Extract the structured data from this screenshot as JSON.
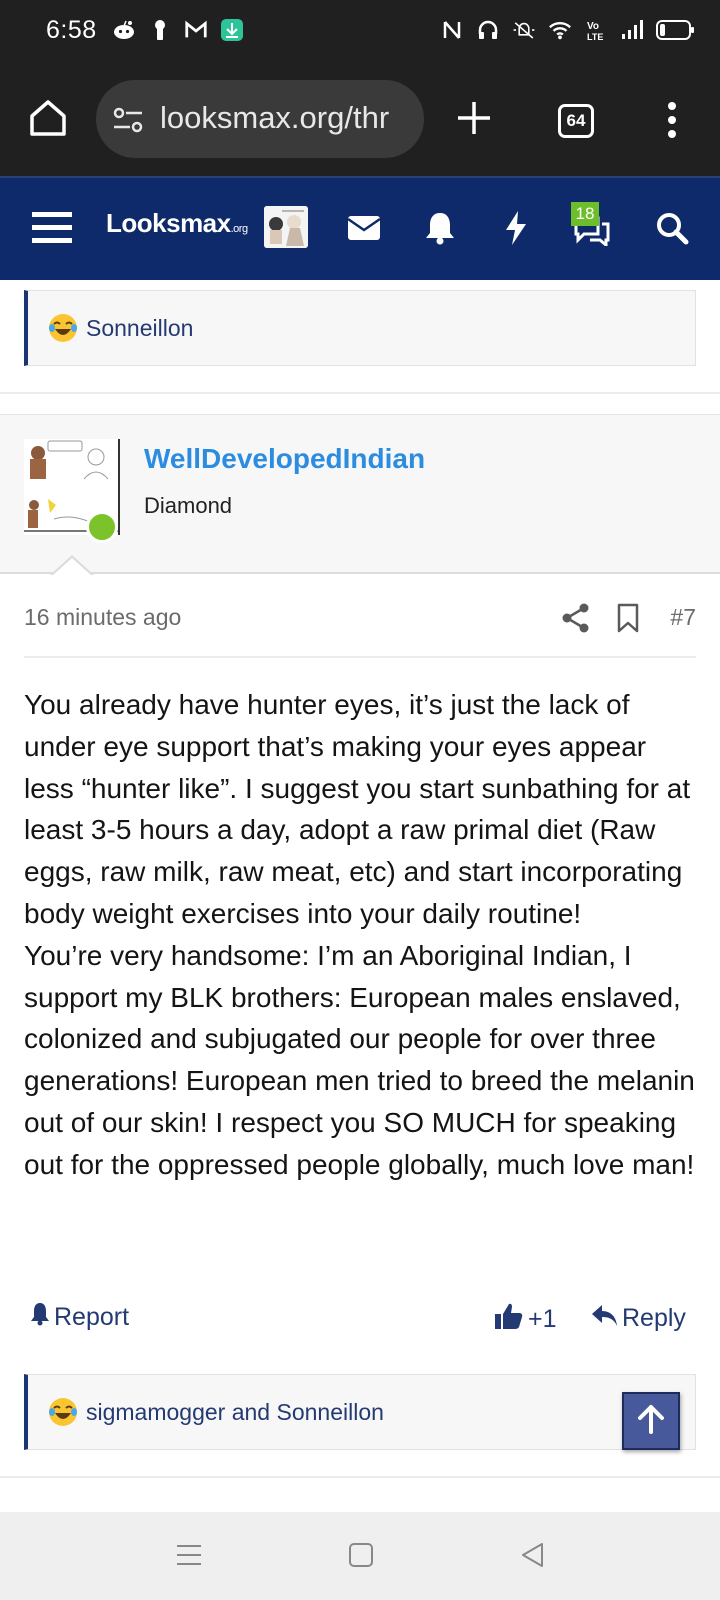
{
  "status_bar": {
    "time": "6:58",
    "left_icons": [
      "reddit-icon",
      "keyhole-icon",
      "gmail-icon",
      "download-icon"
    ],
    "right_icons": [
      "nfc-icon",
      "headset-icon",
      "mute-icon",
      "wifi-icon",
      "volte-icon",
      "signal-icon",
      "battery-icon"
    ]
  },
  "browser": {
    "url": "looksmax.org/thr",
    "tab_count": "64"
  },
  "site_header": {
    "logo_main": "Looksmax",
    "logo_suffix": ".org",
    "chat_badge": "18",
    "brand_color": "#0f2a6b"
  },
  "top_reaction": {
    "emoji": "laughing-crying-icon",
    "users": "Sonneillon"
  },
  "post": {
    "username": "WellDevelopedIndian",
    "user_title": "Diamond",
    "time": "16 minutes ago",
    "number": "#7",
    "paragraphs": [
      "You already have hunter eyes, it’s just the lack of under eye support that’s making your eyes appear less “hunter like”. I suggest you start sunbathing for at least 3-5 hours a day, adopt a raw primal diet (Raw eggs, raw milk, raw meat, etc) and start incorporating body weight exercises into your daily routine!",
      "You’re very handsome: I’m an Aboriginal Indian, I support my BLK brothers: European males enslaved, colonized and subjugated our people for over three generations! European men tried to breed the melanin out of our skin! I respect you SO MUCH for speaking out for the oppressed people globally, much love man!"
    ],
    "actions": {
      "report": "Report",
      "like_count": "+1",
      "reply": "Reply"
    },
    "reaction_users": "sigmamogger and Sonneillon"
  }
}
